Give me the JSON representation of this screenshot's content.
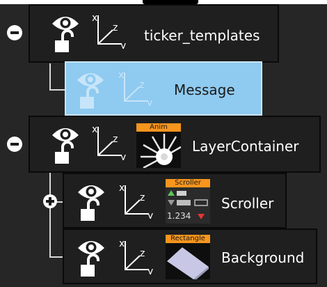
{
  "tree": {
    "nodes": [
      {
        "name": "ticker_templates",
        "expand_state": "collapse",
        "selected": false
      },
      {
        "name": "Message",
        "selected": true
      },
      {
        "name": "LayerContainer",
        "expand_state": "collapse",
        "selected": false,
        "thumbnail": {
          "tag": "Anim",
          "icon": "gear-wheel-icon"
        }
      },
      {
        "name": "Scroller",
        "expand_state": "expand",
        "selected": false,
        "thumbnail": {
          "tag": "Scroller",
          "icon": "scroller-widget-icon",
          "readout": "1.234"
        }
      },
      {
        "name": "Background",
        "selected": false,
        "thumbnail": {
          "tag": "Rectangle",
          "icon": "rectangle-shape-icon"
        }
      }
    ],
    "node_icons": [
      "eye-icon",
      "lock-open-icon",
      "xyz-axes-icon"
    ],
    "axis_labels": {
      "x": "x",
      "y": "y",
      "z": "z"
    }
  },
  "colors": {
    "panel_bg": "#262626",
    "node_bg": "#1f1f1f",
    "selected_bg": "#8fcaf0",
    "accent_tag": "#f7951d"
  }
}
